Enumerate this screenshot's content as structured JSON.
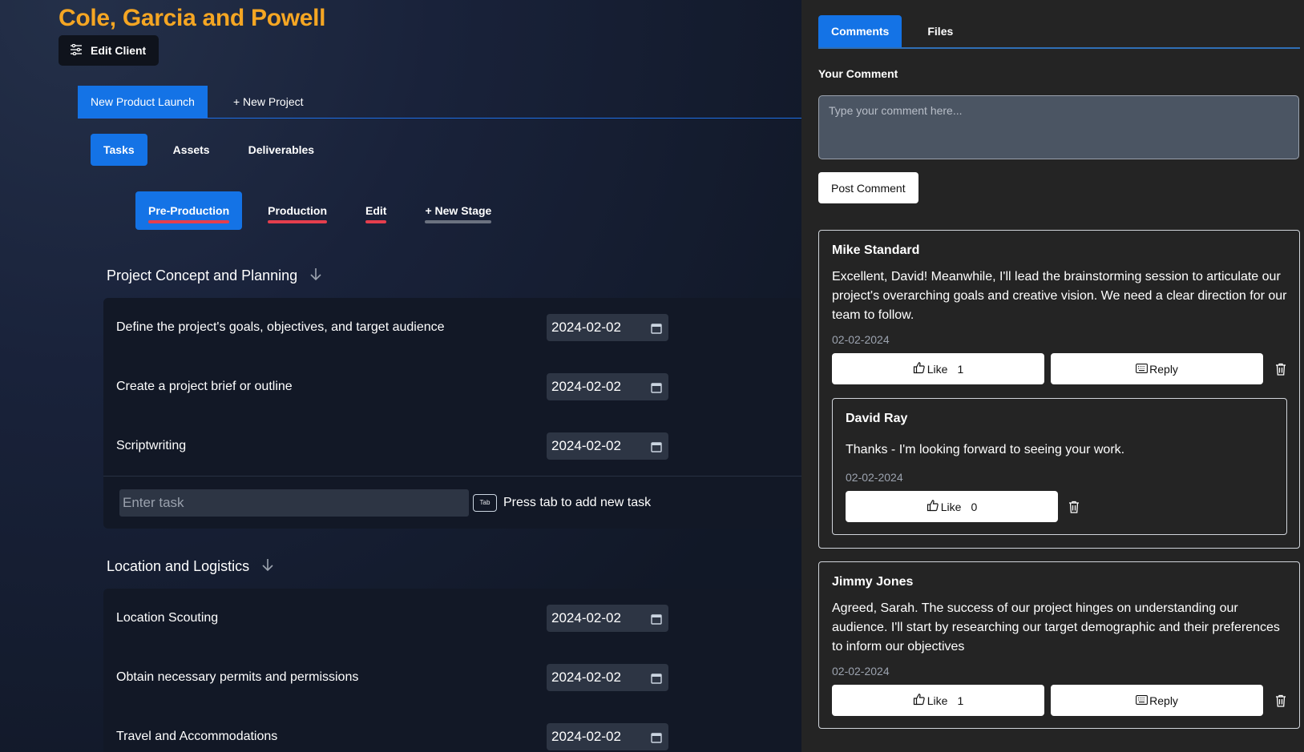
{
  "client": {
    "title": "Cole, Garcia and Powell",
    "edit_label": "Edit Client"
  },
  "project_tabs": [
    {
      "label": "New Product Launch",
      "active": true
    },
    {
      "label": "+ New Project",
      "active": false
    }
  ],
  "sub_tabs": [
    {
      "label": "Tasks",
      "active": true
    },
    {
      "label": "Assets",
      "active": false
    },
    {
      "label": "Deliverables",
      "active": false
    }
  ],
  "stages": [
    {
      "label": "Pre-Production",
      "active": true
    },
    {
      "label": "Production",
      "active": false
    },
    {
      "label": "Edit",
      "active": false
    },
    {
      "label": "+ New Stage",
      "active": false
    }
  ],
  "sections": [
    {
      "title": "Project Concept and Planning",
      "tasks": [
        {
          "name": "Define the project's goals, objectives, and target audience",
          "date": "2024-02-02"
        },
        {
          "name": "Create a project brief or outline",
          "date": "2024-02-02"
        },
        {
          "name": "Scriptwriting",
          "date": "2024-02-02"
        }
      ],
      "task_placeholder": "Enter task",
      "tab_key": "Tab",
      "hint": "Press tab to add new task"
    },
    {
      "title": "Location and Logistics",
      "tasks": [
        {
          "name": "Location Scouting",
          "date": "2024-02-02"
        },
        {
          "name": "Obtain necessary permits and permissions",
          "date": "2024-02-02"
        },
        {
          "name": "Travel and Accommodations",
          "date": "2024-02-02"
        }
      ]
    }
  ],
  "side": {
    "tabs": [
      {
        "label": "Comments",
        "active": true
      },
      {
        "label": "Files",
        "active": false
      }
    ],
    "your_comment_label": "Your Comment",
    "comment_placeholder": "Type your comment here...",
    "post_label": "Post Comment",
    "comments": [
      {
        "author": "Mike Standard",
        "text": "Excellent, David! Meanwhile, I'll lead the brainstorming session to articulate our project's overarching goals and creative vision. We need a clear direction for our team to follow.",
        "date": "02-02-2024",
        "like_label": "Like",
        "likes": "1",
        "reply_label": "Reply",
        "reply": {
          "author": "David Ray",
          "text": "Thanks - I'm looking forward to seeing your work.",
          "date": "02-02-2024",
          "like_label": "Like",
          "likes": "0"
        }
      },
      {
        "author": "Jimmy Jones",
        "text": "Agreed, Sarah. The success of our project hinges on understanding our audience. I'll start by researching our target demographic and their preferences to inform our objectives",
        "date": "02-02-2024",
        "like_label": "Like",
        "likes": "1",
        "reply_label": "Reply"
      }
    ]
  },
  "colors": {
    "accent": "#1473e6",
    "title": "#f5a623",
    "stage_bar": "#e53e4d",
    "stage_bar_inactive": "#6b7280"
  },
  "icons": {
    "edit_client": "sliders-icon",
    "collapse": "arrow-down-icon",
    "calendar": "calendar-icon",
    "like": "thumbs-up-icon",
    "reply": "keyboard-icon",
    "delete": "trash-icon"
  }
}
